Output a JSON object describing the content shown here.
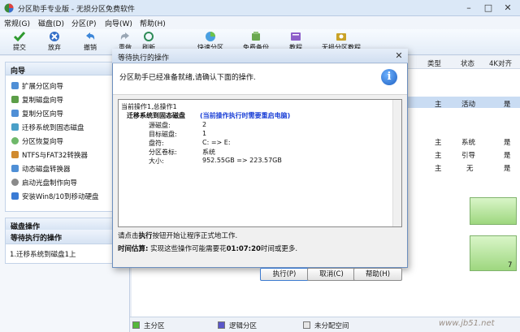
{
  "window": {
    "title": "分区助手专业版 - 无损分区免费软件"
  },
  "menu": [
    "常规(G)",
    "磁盘(D)",
    "分区(P)",
    "向导(W)",
    "帮助(H)"
  ],
  "toolbar": [
    {
      "label": "提交",
      "icon": "commit-icon"
    },
    {
      "label": "放弃",
      "icon": "discard-icon"
    },
    {
      "label": "撤销",
      "icon": "undo-icon"
    },
    {
      "label": "重做",
      "icon": "redo-icon"
    },
    {
      "label": "刷新",
      "icon": "refresh-icon"
    },
    {
      "label": "快速分区",
      "icon": "quick-partition-icon"
    },
    {
      "label": "免费备份",
      "icon": "backup-icon"
    },
    {
      "label": "教程",
      "icon": "tutorial-icon"
    },
    {
      "label": "无损分区教程",
      "icon": "lossless-tutorial-icon"
    }
  ],
  "sidebar": {
    "wizard_title": "向导",
    "wizard_items": [
      "扩展分区向导",
      "复制磁盘向导",
      "复制分区向导",
      "迁移系统到固态磁盘",
      "分区恢复向导",
      "NTFS与FAT32转换器",
      "动态磁盘转换器",
      "启动光盘制作向导",
      "安装Win8/10到移动硬盘"
    ],
    "disk_ops_title": "磁盘操作",
    "pending_title": "等待执行的操作",
    "pending_items": [
      "1.迁移系统到磁盘1上"
    ]
  },
  "table": {
    "headers": [
      "类型",
      "状态",
      "4K对齐"
    ],
    "rows": [
      {
        "type": "主",
        "status": "活动",
        "align": "是"
      },
      {
        "type": "主",
        "status": "系统",
        "align": "是"
      },
      {
        "type": "主",
        "status": "引导",
        "align": "是"
      },
      {
        "type": "主",
        "status": "无",
        "align": "是"
      }
    ],
    "disk_label": "7"
  },
  "legend": [
    "主分区",
    "逻辑分区",
    "未分配空间"
  ],
  "colors": {
    "primary": "#54b83a",
    "logical": "#5a56c9",
    "unallocated": "#e6e6e6"
  },
  "dialog": {
    "title": "等待执行的操作",
    "message": "分区助手已经准备就绪,请确认下面的操作.",
    "current_op": "当前操作1,总操作1",
    "op_title": "迁移系统到固态磁盘",
    "op_note": "(当前操作执行时需要重启电脑)",
    "fields": [
      {
        "k": "源磁盘:",
        "v": "2"
      },
      {
        "k": "目标磁盘:",
        "v": "1"
      },
      {
        "k": "盘符:",
        "v": "C: => E:"
      },
      {
        "k": "分区卷标:",
        "v": "系统"
      },
      {
        "k": "大小:",
        "v": "952.55GB => 223.57GB"
      }
    ],
    "hint_pre": "请点击",
    "hint_bold": "执行",
    "hint_post": "按钮开始让程序正式地工作.",
    "time_label": "时间估算:",
    "time_pre": "实现这些操作可能需要花",
    "time_value": "01:07:20",
    "time_post": "时间或更多.",
    "buttons": [
      "执行(P)",
      "取消(C)",
      "帮助(H)"
    ]
  },
  "watermark": "www.jb51.net"
}
